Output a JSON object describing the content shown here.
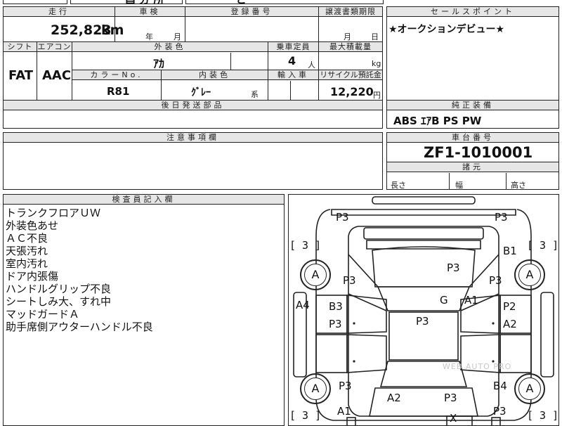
{
  "top": {
    "cut_text": "昌 分 所",
    "cut_text2": "ど"
  },
  "mileage": {
    "header": "走行",
    "value": "252,823",
    "unit": "km"
  },
  "inspection": {
    "header": "車検",
    "year": "年",
    "month": "月"
  },
  "registration": {
    "header": "登録番号"
  },
  "transfer": {
    "header": "譲渡書類期限",
    "month": "月",
    "day": "日"
  },
  "shift": {
    "header": "シフト",
    "value": "FAT"
  },
  "aircon": {
    "header": "エアコン",
    "value": "AAC"
  },
  "exterior_color": {
    "header": "外装色",
    "value": "ｱｶ"
  },
  "capacity": {
    "header": "乗車定員",
    "value": "4",
    "unit": "人"
  },
  "max_load": {
    "header": "最大積載量",
    "unit": "kg"
  },
  "color_no": {
    "header": "カラーNo.",
    "value": "R81"
  },
  "interior_color": {
    "header": "内装色",
    "value": "ｸﾞﾚｰ",
    "suffix": "系"
  },
  "import": {
    "header": "輸入車"
  },
  "recycle": {
    "header": "リサイクル預託金",
    "value": "12,220",
    "unit": "円"
  },
  "later_parts": {
    "header": "後日発送部品"
  },
  "sales_point": {
    "header": "セールスポイント",
    "text": "★オークションデビュー★"
  },
  "equipment": {
    "header": "純正装備",
    "text": "ABS ｴｱB PS PW"
  },
  "notes_header": "注意事項欄",
  "chassis": {
    "header": "車台番号",
    "value": "ZF1-1010001"
  },
  "dims": {
    "header": "諸元",
    "length": "長さ",
    "width": "幅",
    "height": "高さ"
  },
  "inspector": {
    "header": "検査員記入欄",
    "lines": [
      "トランクフロアＵＷ",
      "外装色あせ",
      "ＡＣ不良",
      "天張汚れ",
      "室内汚れ",
      "ドア内張傷",
      "ハンドルグリップ不良",
      "シートしみ大、すれ中",
      "マッドガードＡ",
      "助手席側アウターハンドル不良"
    ]
  },
  "diagram": {
    "marks": {
      "p3_tl": "P3",
      "p3_tr": "P3",
      "b1": "B1",
      "p3_hood": "P3",
      "p3_lf": "P3",
      "p3_rf": "P3",
      "a4": "A4",
      "b3": "B3",
      "g": "G",
      "a1_mid": "A1",
      "p2": "P2",
      "p3_ld": "P3",
      "p3_center": "P3",
      "a2_rd": "A2",
      "p3_lr": "P3",
      "b4": "B4",
      "a2_bottom": "A2",
      "p3_bottom": "P3",
      "a1_bottom": "A1",
      "p3_br": "P3",
      "x": "X"
    },
    "wheels": {
      "lf": "A",
      "rf": "A",
      "lr": "A",
      "rr": "A"
    },
    "brackets": {
      "tl": "[ 3 ]",
      "tr": "[ 3 ]",
      "bl": "[ 3 ]",
      "br": "[ 3 ]"
    },
    "watermark": "WEB AUTO PRO"
  }
}
